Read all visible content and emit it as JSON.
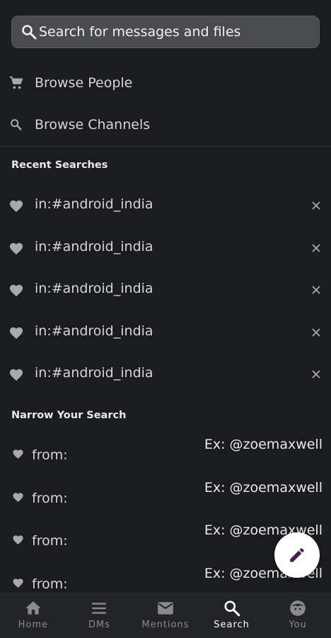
{
  "search": {
    "placeholder": "Search for messages and files"
  },
  "browse": [
    {
      "label": "Browse People",
      "icon": "cart-icon"
    },
    {
      "label": "Browse Channels",
      "icon": "search-icon"
    }
  ],
  "recent": {
    "title": "Recent Searches",
    "items": [
      {
        "label": "in:#android_india"
      },
      {
        "label": "in:#android_india"
      },
      {
        "label": "in:#android_india"
      },
      {
        "label": "in:#android_india"
      },
      {
        "label": "in:#android_india"
      }
    ]
  },
  "narrow": {
    "title": "Narrow Your Search",
    "items": [
      {
        "label": "from:",
        "example": "Ex: @zoemaxwell"
      },
      {
        "label": "from:",
        "example": "Ex: @zoemaxwell"
      },
      {
        "label": "from:",
        "example": "Ex: @zoemaxwell"
      },
      {
        "label": "from:",
        "example": "Ex: @zoemaxwell"
      }
    ]
  },
  "fab": {
    "icon": "pencil-icon",
    "color": "#4a1d4e"
  },
  "nav": {
    "active": "Search",
    "items": [
      {
        "label": "Home",
        "icon": "home-icon"
      },
      {
        "label": "DMs",
        "icon": "menu-icon"
      },
      {
        "label": "Mentions",
        "icon": "mail-icon"
      },
      {
        "label": "Search",
        "icon": "search-icon"
      },
      {
        "label": "You",
        "icon": "face-icon"
      }
    ]
  },
  "colors": {
    "background": "#1b1c1f",
    "search_bar": "#4a4b4e",
    "text": "#d6d6d6",
    "nav_bg": "#232427",
    "nav_inactive": "#8a8b8e",
    "nav_active": "#ffffff"
  }
}
